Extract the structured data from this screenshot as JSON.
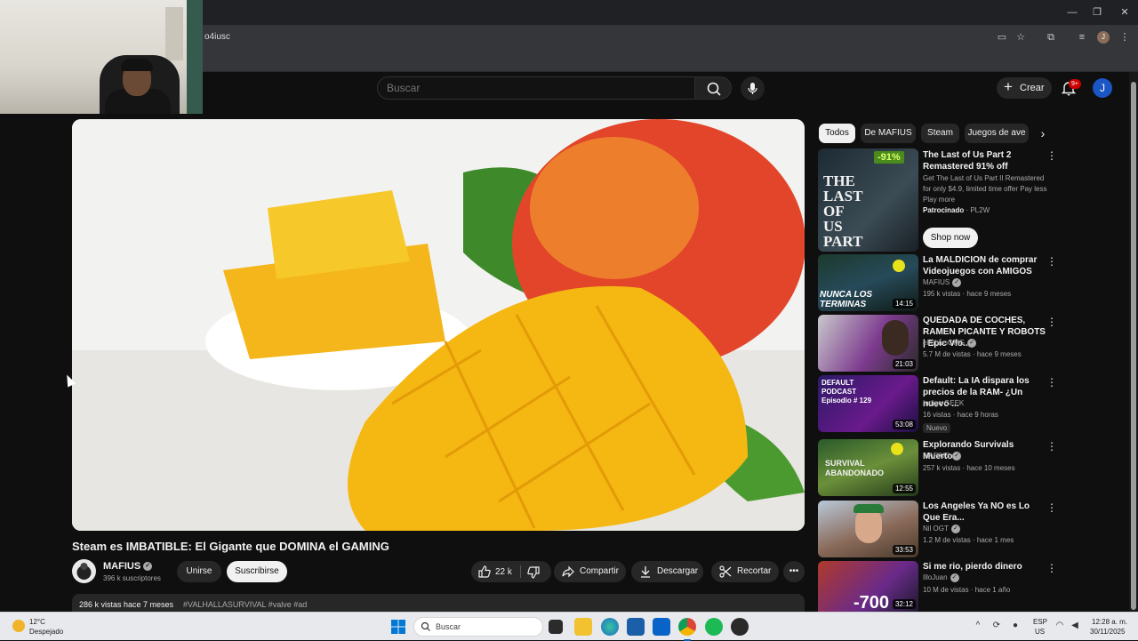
{
  "browser": {
    "url_fragment": "o4iusc",
    "profile_initial": "J"
  },
  "header": {
    "search_placeholder": "Buscar",
    "create_label": "Crear",
    "notif_badge": "9+",
    "avatar_initial": "J"
  },
  "video": {
    "title": "Steam es IMBATIBLE: El Gigante que DOMINA el GAMING",
    "channel": "MAFIUS",
    "subscribers": "396 k suscriptores",
    "join_label": "Unirse",
    "subscribe_label": "Suscribirse",
    "likes": "22 k",
    "share_label": "Compartir",
    "download_label": "Descargar",
    "clip_label": "Recortar",
    "views_date": "286 k vistas  hace 7 meses",
    "hashtags": "#VALHALLASURVIVAL #valve #ad"
  },
  "chips": [
    "Todos",
    "De MAFIUS",
    "Steam",
    "Juegos de ave"
  ],
  "ad": {
    "discount": "-91%",
    "thumb_text": "THE LAST OF US PART II PC",
    "title": "The Last of Us Part 2 Remastered 91% off",
    "description": "Get The Last of Us Part II Remastered for only $4.9, limited time offer Pay less Play more",
    "sponsor_label": "Patrocinado",
    "sponsor_name": "PL2W",
    "cta": "Shop now"
  },
  "recommendations": [
    {
      "title": "La MALDICION de comprar Videojuegos con AMIGOS",
      "channel": "MAFIUS",
      "verified": true,
      "meta": "195 k vistas · hace 9 meses",
      "duration": "14:15",
      "thumb_text": "NUNCA LOS TERMINAS"
    },
    {
      "title": "QUEDADA DE COCHES, RAMEN PICANTE Y ROBOTS | Epic Vlo...",
      "channel": "elrubiusOMG",
      "verified": true,
      "meta": "5.7 M de vistas · hace 9 meses",
      "duration": "21:03",
      "thumb_text": ""
    },
    {
      "title": "Default: La IA dispara los precios de la RAM- ¿Un nuevo ...",
      "channel": "Indigo GEEK",
      "verified": false,
      "meta": "16 vistas · hace 9 horas",
      "duration": "53:08",
      "badge": "Nuevo",
      "thumb_text": "DEFAULT PODCAST Episodio # 129"
    },
    {
      "title": "Explorando Survivals Muertos",
      "channel": "MAFIUS",
      "verified": true,
      "meta": "257 k vistas · hace 10 meses",
      "duration": "12:55",
      "thumb_text": "SURVIVAL ABANDONADO"
    },
    {
      "title": "Los Angeles Ya NO es Lo Que Era...",
      "channel": "Nil OGT",
      "verified": true,
      "meta": "1.2 M de vistas · hace 1 mes",
      "duration": "33:53",
      "thumb_text": ""
    },
    {
      "title": "Si me rio, pierdo dinero",
      "channel": "IlloJuan",
      "verified": true,
      "meta": "10 M de vistas · hace 1 año",
      "duration": "32:12",
      "thumb_text": "-700"
    }
  ],
  "taskbar": {
    "temp": "12°C",
    "weather": "Despejado",
    "search_label": "Buscar",
    "lang1": "ESP",
    "lang2": "US",
    "time": "12:28 a. m.",
    "date": "30/11/2025"
  }
}
